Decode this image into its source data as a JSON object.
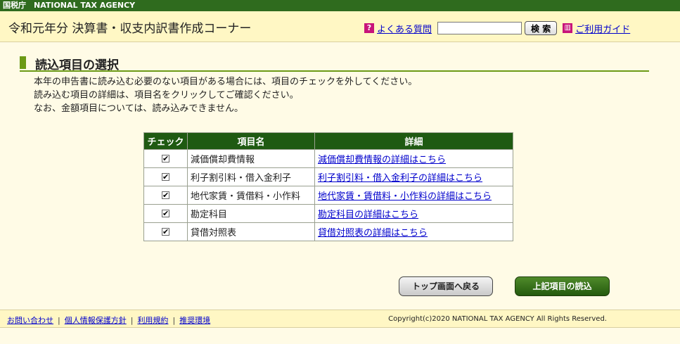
{
  "agency_bar": "国税庁　NATIONAL TAX AGENCY",
  "header": {
    "title": "令和元年分 決算書・収支内訳書作成コーナー",
    "faq_label": "よくある質問",
    "search_placeholder": "",
    "search_button": "検 索",
    "guide_label": "ご利用ガイド"
  },
  "section": {
    "heading": "読込項目の選択",
    "desc_line1": "本年の申告書に読み込む必要のない項目がある場合には、項目のチェックを外してください。",
    "desc_line2": "読み込む項目の詳細は、項目名をクリックしてご確認ください。",
    "desc_line3": "なお、金額項目については、読み込みできません。"
  },
  "table": {
    "headers": [
      "チェック",
      "項目名",
      "詳細"
    ],
    "rows": [
      {
        "checked": true,
        "name": "減価償却費情報",
        "detail": "減価償却費情報の詳細はこちら"
      },
      {
        "checked": true,
        "name": "利子割引料・借入金利子",
        "detail": "利子割引料・借入金利子の詳細はこちら"
      },
      {
        "checked": true,
        "name": "地代家賃・賃借料・小作料",
        "detail": "地代家賃・賃借料・小作料の詳細はこちら"
      },
      {
        "checked": true,
        "name": "勘定科目",
        "detail": "勘定科目の詳細はこちら"
      },
      {
        "checked": true,
        "name": "貸借対照表",
        "detail": "貸借対照表の詳細はこちら"
      }
    ]
  },
  "buttons": {
    "back": "トップ画面へ戻る",
    "load": "上記項目の読込"
  },
  "footer": {
    "links": [
      "お問い合わせ",
      "個人情報保護方針",
      "利用規約",
      "推奨環境"
    ],
    "copyright": "Copyright(c)2020 NATIONAL TAX AGENCY All Rights Reserved."
  },
  "colors": {
    "agency_bar": "#2f6b1e",
    "header_bg": "#fff7c4",
    "table_header": "#1f5a12",
    "accent_green": "#6c9a16",
    "link": "#0000cc"
  },
  "icons": {
    "faq": "question-icon",
    "guide": "book-icon"
  }
}
